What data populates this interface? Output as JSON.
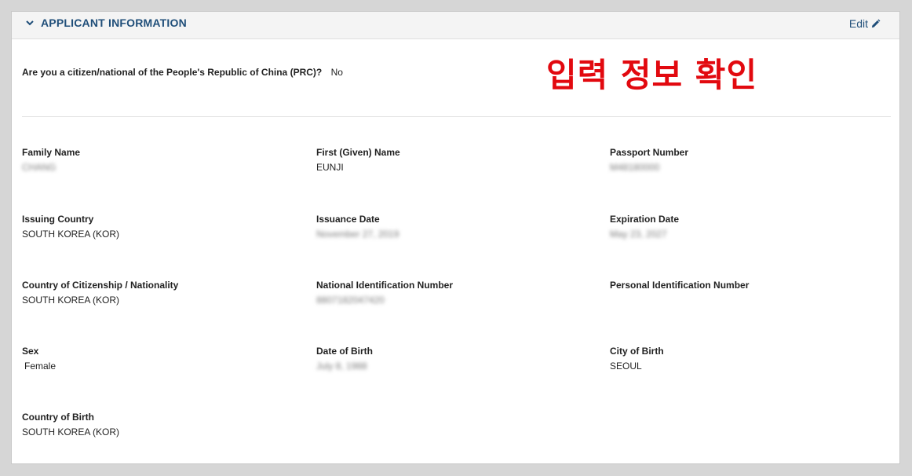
{
  "section": {
    "title": "APPLICANT INFORMATION",
    "edit_label": "Edit"
  },
  "prc": {
    "question": "Are you a citizen/national of the People's Republic of China (PRC)?",
    "answer": "No"
  },
  "annotation": "입력 정보 확인",
  "fields": {
    "family_name": {
      "label": "Family Name",
      "value": "CHANG"
    },
    "first_name": {
      "label": "First (Given) Name",
      "value": "EUNJI"
    },
    "passport_number": {
      "label": "Passport Number",
      "value": "M48180000"
    },
    "issuing_country": {
      "label": "Issuing Country",
      "value": "SOUTH KOREA (KOR)"
    },
    "issuance_date": {
      "label": "Issuance Date",
      "value": "November 27, 2019"
    },
    "expiration_date": {
      "label": "Expiration Date",
      "value": "May 23, 2027"
    },
    "citizenship": {
      "label": "Country of Citizenship / Nationality",
      "value": "SOUTH KOREA (KOR)"
    },
    "national_id": {
      "label": "National Identification Number",
      "value": "8807182047420"
    },
    "personal_id": {
      "label": "Personal Identification Number",
      "value": ""
    },
    "sex": {
      "label": "Sex",
      "value": "Female"
    },
    "dob": {
      "label": "Date of Birth",
      "value": "July 8, 1988"
    },
    "city_of_birth": {
      "label": "City of Birth",
      "value": "SEOUL"
    },
    "country_of_birth": {
      "label": "Country of Birth",
      "value": "SOUTH KOREA (KOR)"
    }
  }
}
